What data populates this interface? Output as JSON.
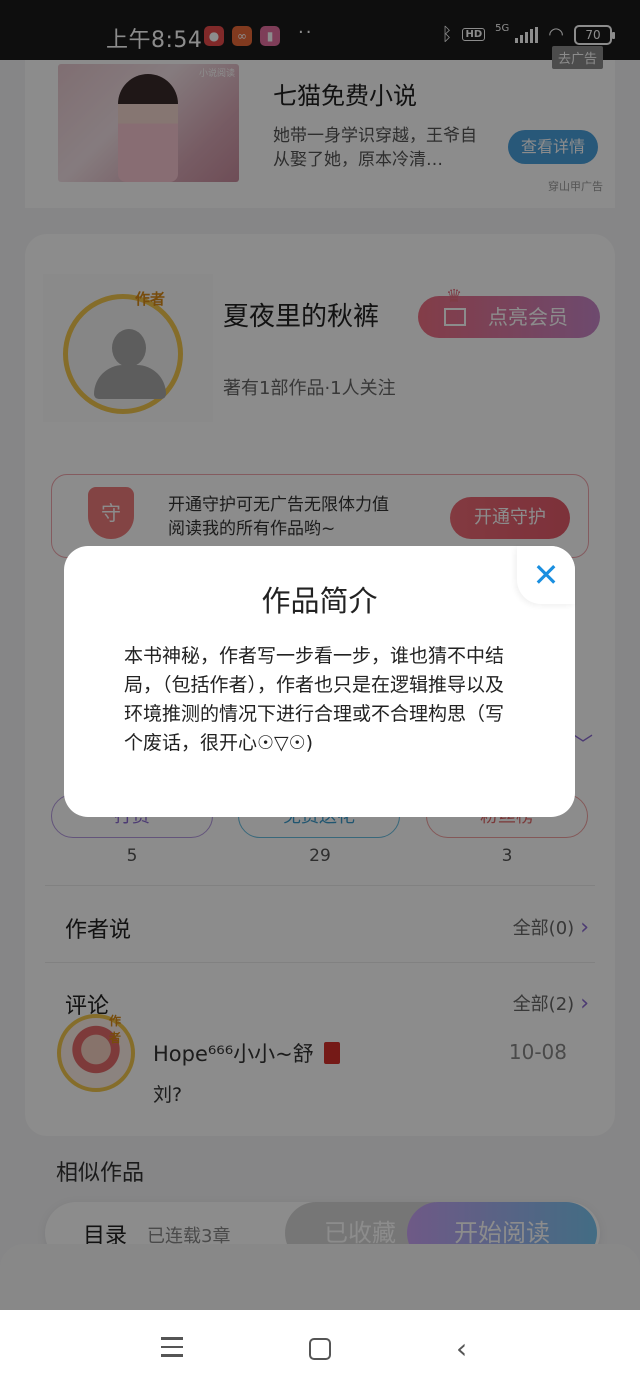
{
  "status_bar": {
    "time": "上午8:54",
    "dots": "··",
    "network": "5G",
    "hd": "HD",
    "battery": "70"
  },
  "ad": {
    "image_tag": "小说阅读",
    "title": "七猫免费小说",
    "description": "她带一身学识穿越，王爷自从娶了她，原本冷清…",
    "button": "查看详情",
    "close_label": "去广告",
    "source": "穿山甲广告"
  },
  "author": {
    "badge": "作者",
    "name": "夏夜里的秋裤",
    "meta": "著有1部作品·1人关注",
    "vip_button": "点亮会员"
  },
  "guard": {
    "shield": "守",
    "text_line1": "开通守护可无广告无限体力值",
    "text_line2": "阅读我的所有作品哟~",
    "button": "开通守护"
  },
  "stats": [
    {
      "label": "打赏",
      "count": "5"
    },
    {
      "label": "免费送花",
      "count": "29"
    },
    {
      "label": "粉丝榜",
      "count": "3"
    }
  ],
  "author_says": {
    "title": "作者说",
    "more": "全部(0)"
  },
  "comments": {
    "title": "评论",
    "more": "全部(2)",
    "items": [
      {
        "user": "Hope⁶⁶⁶小小~舒",
        "date": "10-08",
        "text": "刘?"
      }
    ]
  },
  "similar": {
    "title": "相似作品"
  },
  "bottom_bar": {
    "toc": "目录",
    "chapters": "已连载3章",
    "favorited": "已收藏",
    "read": "开始阅读"
  },
  "modal": {
    "title": "作品简介",
    "body": "本书神秘，作者写一步看一步，谁也猜不中结局，（包括作者），作者也只是在逻辑推导以及环境推测的情况下进行合理或不合理构思（写个废话，很开心☉▽☉)",
    "close": "✕"
  },
  "colors": {
    "accent_purple": "#8a6ad1",
    "accent_blue": "#1a8fe0",
    "guard_red": "#e35a6a"
  }
}
